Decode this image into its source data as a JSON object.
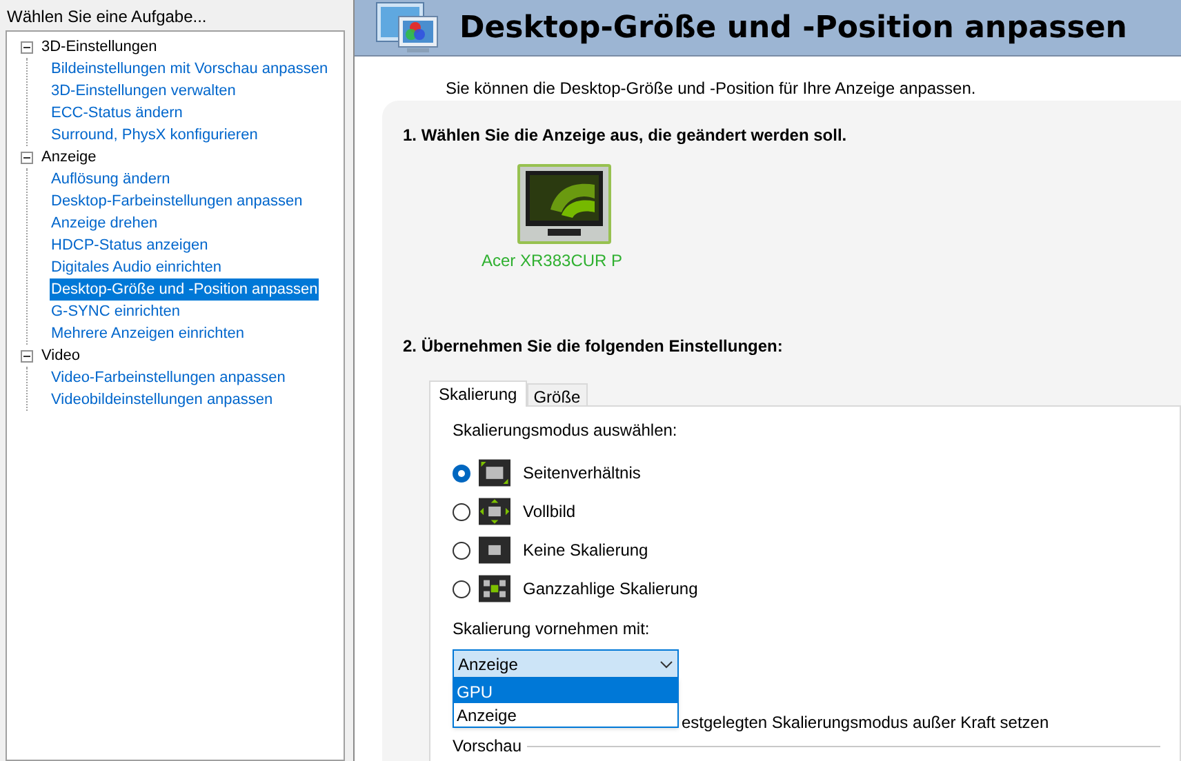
{
  "left_panel": {
    "title": "Wählen Sie eine Aufgabe...",
    "tree": [
      {
        "label": "3D-Einstellungen",
        "expanded": true,
        "children": [
          {
            "label": "Bildeinstellungen mit Vorschau anpassen",
            "selected": false
          },
          {
            "label": "3D-Einstellungen verwalten",
            "selected": false
          },
          {
            "label": "ECC-Status ändern",
            "selected": false
          },
          {
            "label": "Surround, PhysX konfigurieren",
            "selected": false
          }
        ]
      },
      {
        "label": "Anzeige",
        "expanded": true,
        "children": [
          {
            "label": "Auflösung ändern",
            "selected": false
          },
          {
            "label": "Desktop-Farbeinstellungen anpassen",
            "selected": false
          },
          {
            "label": "Anzeige drehen",
            "selected": false
          },
          {
            "label": "HDCP-Status anzeigen",
            "selected": false
          },
          {
            "label": "Digitales Audio einrichten",
            "selected": false
          },
          {
            "label": "Desktop-Größe und -Position anpassen",
            "selected": true
          },
          {
            "label": "G-SYNC einrichten",
            "selected": false
          },
          {
            "label": "Mehrere Anzeigen einrichten",
            "selected": false
          }
        ]
      },
      {
        "label": "Video",
        "expanded": true,
        "children": [
          {
            "label": "Video-Farbeinstellungen anpassen",
            "selected": false
          },
          {
            "label": "Videobildeinstellungen anpassen",
            "selected": false
          }
        ]
      }
    ]
  },
  "header": {
    "title": "Desktop-Größe und -Position anpassen"
  },
  "description": "Sie können die Desktop-Größe und -Position für Ihre Anzeige anpassen.",
  "step_1": {
    "heading": "1. Wählen Sie die Anzeige aus, die geändert werden soll.",
    "displays": [
      {
        "name": "Acer XR383CUR P",
        "selected": true
      }
    ]
  },
  "step_2": {
    "heading": "2. Übernehmen Sie die folgenden Einstellungen:",
    "tabs": [
      {
        "label": "Skalierung",
        "selected": true
      },
      {
        "label": "Größe",
        "selected": false
      }
    ],
    "scaling_mode_label": "Skalierungsmodus auswählen:",
    "scaling_modes": [
      {
        "label": "Seitenverhältnis",
        "kind": "aspect",
        "selected": true
      },
      {
        "label": "Vollbild",
        "kind": "full",
        "selected": false
      },
      {
        "label": "Keine Skalierung",
        "kind": "none",
        "selected": false
      },
      {
        "label": "Ganzzahlige Skalierung",
        "kind": "integer",
        "selected": false
      }
    ],
    "perform_label": "Skalierung vornehmen mit:",
    "perform_dropdown": {
      "value": "Anzeige",
      "expanded": true,
      "options": [
        {
          "label": "GPU",
          "highlighted": true
        },
        {
          "label": "Anzeige",
          "highlighted": false
        }
      ]
    },
    "override_text": "estgelegten Skalierungsmodus außer Kraft setzen",
    "preview_label": "Vorschau"
  }
}
